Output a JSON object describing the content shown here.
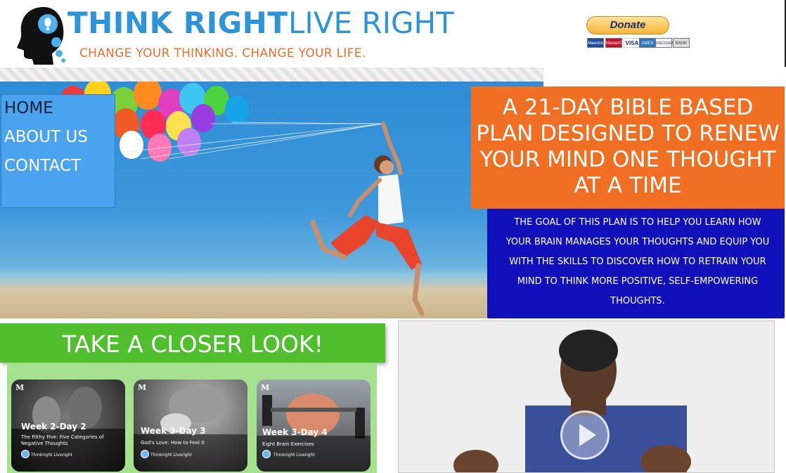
{
  "header": {
    "brand_strong": "THINK RIGHT",
    "brand_light": "LIVE RIGHT",
    "tagline": "CHANGE YOUR THINKING. CHANGE YOUR LIFE."
  },
  "donate": {
    "label": "Donate",
    "cards": [
      "Maestro",
      "MasterCard",
      "VISA",
      "AMEX",
      "DISCOVER",
      "BANK"
    ]
  },
  "nav": {
    "items": [
      {
        "label": "HOME"
      },
      {
        "label": "ABOUT US"
      },
      {
        "label": "CONTACT"
      }
    ]
  },
  "plan": {
    "title": "A 21-DAY BIBLE BASED PLAN DESIGNED TO RENEW YOUR MIND ONE THOUGHT AT A TIME",
    "goal": "THE GOAL OF THIS PLAN IS TO HELP YOU LEARN HOW YOUR BRAIN MANAGES YOUR THOUGHTS AND EQUIP YOU WITH THE SKILLS TO DISCOVER HOW TO RETRAIN YOUR MIND TO THINK MORE POSITIVE, SELF-EMPOWERING THOUGHTS."
  },
  "closer": {
    "title": "TAKE A CLOSER LOOK!",
    "cards": [
      {
        "badge": "M",
        "title": "Week 2-Day 2",
        "subtitle": "The Filthy Five: Five Categories of Negative Thoughts",
        "author": "Thinkright Liveright"
      },
      {
        "badge": "M",
        "title": "Week 3-Day 3",
        "subtitle": "God's Love: How to Feel it",
        "author": "Thinkright Liveright"
      },
      {
        "badge": "M",
        "title": "Week 3-Day 4",
        "subtitle": "Eight Brain Exercises",
        "author": "Thinkright Liveright"
      }
    ]
  },
  "colors": {
    "brand_blue": "#2b95d7",
    "tagline_orange": "#ee6f2a",
    "plan_orange": "#f06f23",
    "goal_blue": "#1111bb",
    "nav_blue": "#49a3ef",
    "closer_green": "#4fbf2e"
  }
}
